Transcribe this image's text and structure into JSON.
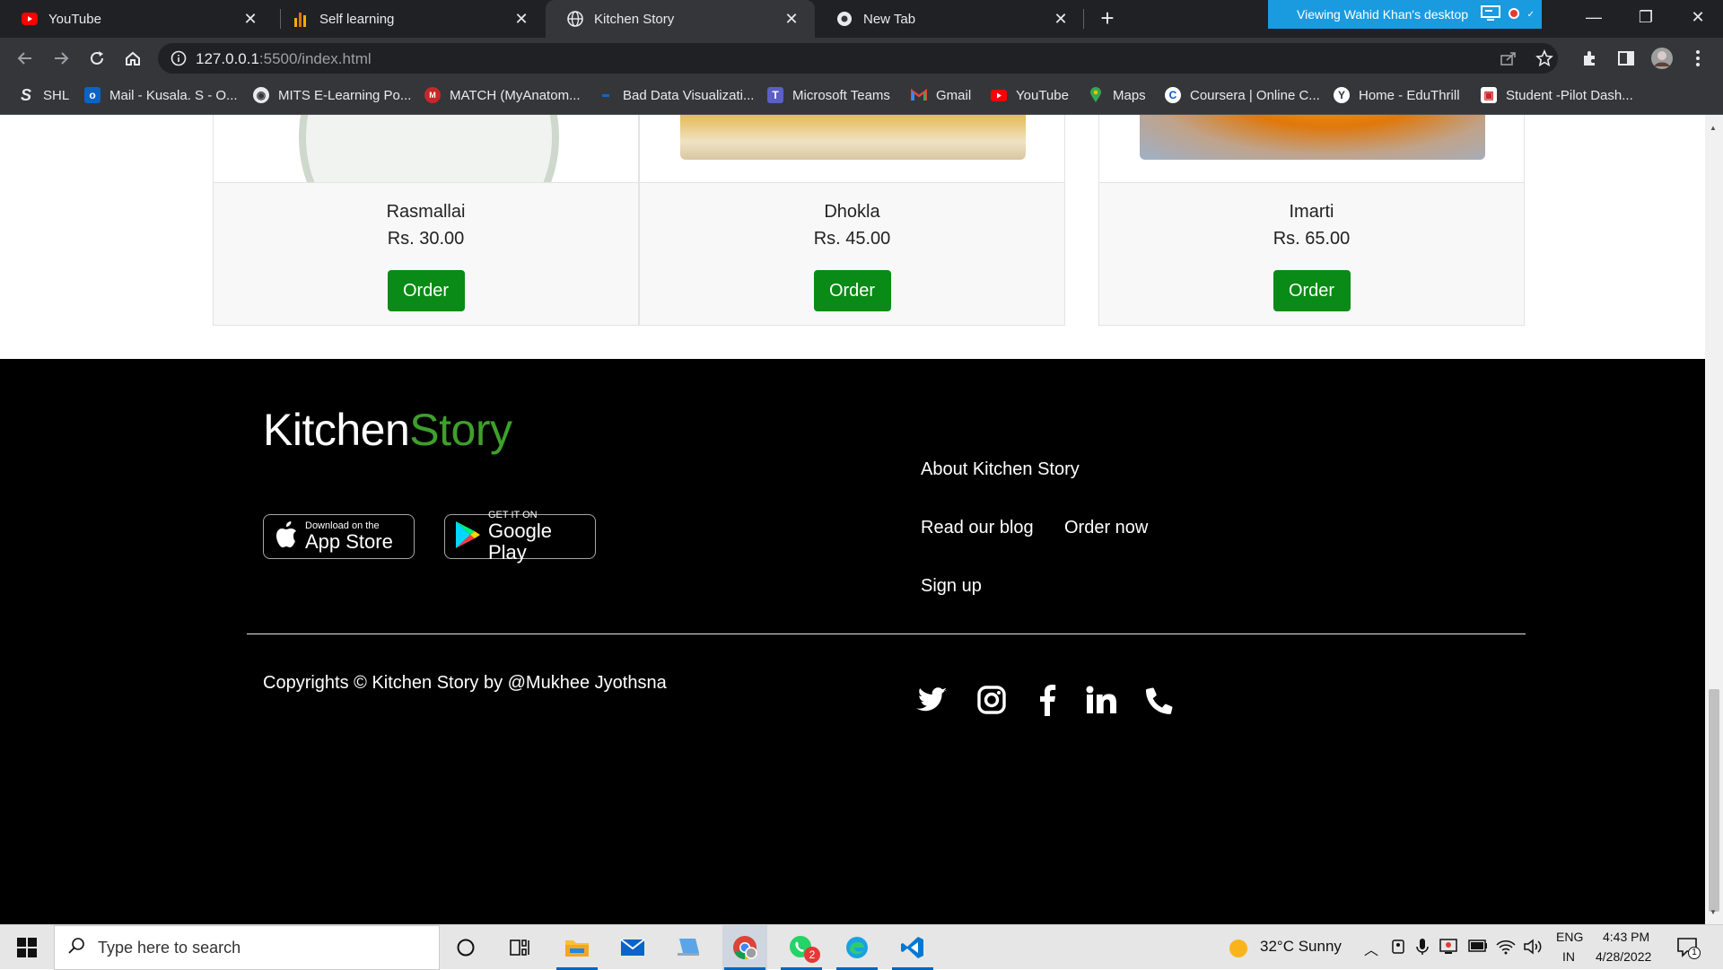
{
  "browser": {
    "tabs": [
      {
        "title": "YouTube",
        "active": false,
        "icon": "youtube-icon"
      },
      {
        "title": "Self learning",
        "active": false,
        "icon": "analytics-icon"
      },
      {
        "title": "Kitchen Story",
        "active": true,
        "icon": "globe-icon"
      },
      {
        "title": "New Tab",
        "active": false,
        "icon": "chrome-icon"
      }
    ],
    "remote_banner": "Viewing Wahid Khan's desktop",
    "url_host": "127.0.0.1",
    "url_rest": ":5500/index.html",
    "bookmarks": [
      {
        "label": "SHL",
        "icon": "shl-icon"
      },
      {
        "label": "Mail - Kusala. S - O...",
        "icon": "outlook-icon"
      },
      {
        "label": "MITS E-Learning Po...",
        "icon": "mits-icon"
      },
      {
        "label": "MATCH (MyAnatom...",
        "icon": "match-icon"
      },
      {
        "label": "Bad Data Visualizati...",
        "icon": "article-icon"
      },
      {
        "label": "Microsoft Teams",
        "icon": "teams-icon"
      },
      {
        "label": "Gmail",
        "icon": "gmail-icon"
      },
      {
        "label": "YouTube",
        "icon": "youtube-icon"
      },
      {
        "label": "Maps",
        "icon": "maps-icon"
      },
      {
        "label": "Coursera | Online C...",
        "icon": "coursera-icon"
      },
      {
        "label": "Home - EduThrill",
        "icon": "eduthrill-icon"
      },
      {
        "label": "Student -Pilot Dash...",
        "icon": "pilot-icon"
      }
    ]
  },
  "page": {
    "products": [
      {
        "name": "Rasmallai",
        "price": "Rs. 30.00",
        "button": "Order"
      },
      {
        "name": "Dhokla",
        "price": "Rs. 45.00",
        "button": "Order"
      },
      {
        "name": "Imarti",
        "price": "Rs. 65.00",
        "button": "Order"
      }
    ],
    "footer": {
      "brand_part1": "Kitchen",
      "brand_part2": "Story",
      "app_store_small": "Download on the",
      "app_store_big": "App Store",
      "google_play_small": "GET IT ON",
      "google_play_big": "Google Play",
      "links": {
        "about": "About Kitchen Story",
        "blog": "Read our blog",
        "order": "Order now",
        "signup": "Sign up"
      },
      "copyright": "Copyrights © Kitchen Story by @Mukhee Jyothsna",
      "social": [
        "twitter-icon",
        "instagram-icon",
        "facebook-icon",
        "linkedin-icon",
        "phone-icon"
      ]
    }
  },
  "taskbar": {
    "search_placeholder": "Type here to search",
    "weather": "32°C  Sunny",
    "lang_line1": "ENG",
    "lang_line2": "IN",
    "time": "4:43 PM",
    "date": "4/28/2022",
    "whatsapp_badge": "2",
    "notification_count": "1"
  },
  "colors": {
    "order_button": "#0a8a16",
    "brand_green": "#3f9f2b",
    "footer_bg": "#000000",
    "remote_banner": "#1a9be0"
  }
}
